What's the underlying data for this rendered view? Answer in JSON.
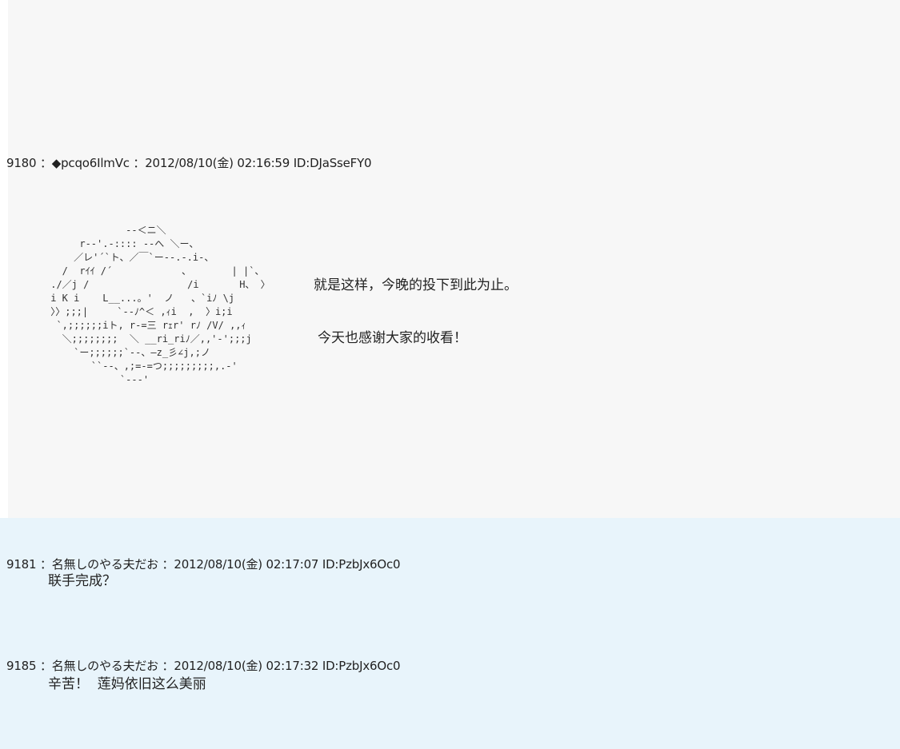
{
  "posts": [
    {
      "number": "9180",
      "separator": "：",
      "name": "◆pcqo6IlmVc",
      "date": "2012/08/10(金) 02:16:59",
      "id": "ID:DJaSseFY0",
      "ascii_art": "              ‐-＜ニ＼\n      r‐‐'.-:::: -‐へ ＼ー、\n     ／レ'´`ト、／￣`ー‐‐.‐.i-、\n   /  rｲｲ /´            、       | |`、\n ./／j /                 /i       H、 〉\n i K i    L__...。'  ノ   、`iﾉ \\j\n 〉〉;;;|     `‐‐ﾉ^＜ ,ｨi  ,  〉i;i\n  `,;;;;;;iト, r-=三 rｪr' rﾉ /V/ ,,ｨ\n   ＼;;;;;;;;  ＼ __ri_riﾉ／,,'-';;;j\n     `ー;;;;;;`‐‐、―z_彡∠j,;ノ\n        ``‐‐、,;=-=つ;;;;;;;;;,.-'\n             `‐-‐'",
      "dialog": [
        "就是这样，今晚的投下到此为止。",
        "今天也感谢大家的收看！"
      ]
    },
    {
      "number": "9181",
      "separator": "：",
      "name": "名無しのやる夫だお",
      "date": "2012/08/10(金) 02:17:07",
      "id": "ID:PzbJx6Oc0",
      "body": "联手完成？"
    },
    {
      "number": "9185",
      "separator": "：",
      "name": "名無しのやる夫だお",
      "date": "2012/08/10(金) 02:17:32",
      "id": "ID:PzbJx6Oc0",
      "body": "辛苦！  莲妈依旧这么美丽"
    }
  ]
}
